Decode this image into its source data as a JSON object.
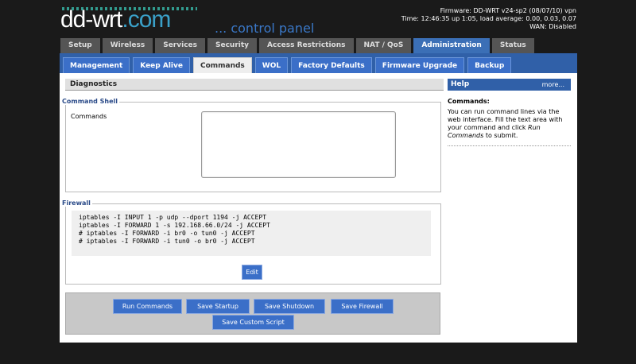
{
  "logo": {
    "main": "dd-wrt",
    "dotcom": ".com",
    "sub": "... control panel"
  },
  "header_info": {
    "firmware": "Firmware: DD-WRT v24-sp2 (08/07/10) vpn",
    "time": "Time: 12:46:35 up 1:05, load average: 0.00, 0.03, 0.07",
    "wan": "WAN: Disabled"
  },
  "main_tabs": [
    "Setup",
    "Wireless",
    "Services",
    "Security",
    "Access Restrictions",
    "NAT / QoS",
    "Administration",
    "Status"
  ],
  "active_main_tab": "Administration",
  "sub_tabs": [
    "Management",
    "Keep Alive",
    "Commands",
    "WOL",
    "Factory Defaults",
    "Firmware Upgrade",
    "Backup"
  ],
  "active_sub_tab": "Commands",
  "section_title": "Diagnostics",
  "command_shell": {
    "legend": "Command Shell",
    "label": "Commands",
    "value": ""
  },
  "firewall": {
    "legend": "Firewall",
    "lines": [
      "iptables -I INPUT 1 -p udp --dport 1194 -j ACCEPT",
      "iptables -I FORWARD 1 -s 192.168.66.0/24 -j ACCEPT",
      "# iptables -I FORWARD -i br0 -o tun0 -j ACCEPT",
      "# iptables -I FORWARD -i tun0 -o br0 -j ACCEPT"
    ],
    "edit_label": "Edit"
  },
  "buttons": {
    "run": "Run Commands",
    "save_startup": "Save Startup",
    "save_shutdown": "Save Shutdown",
    "save_firewall": "Save Firewall",
    "save_custom": "Save Custom Script"
  },
  "help": {
    "title": "Help",
    "more": "more...",
    "heading": "Commands:",
    "text_1": "You can run command lines via the web interface. Fill the text area with your command and click ",
    "text_em": "Run Commands",
    "text_2": " to submit."
  },
  "colors": {
    "accent": "#3b6fc8",
    "nav_bar": "#3060a8",
    "legend": "#2a4a88"
  }
}
